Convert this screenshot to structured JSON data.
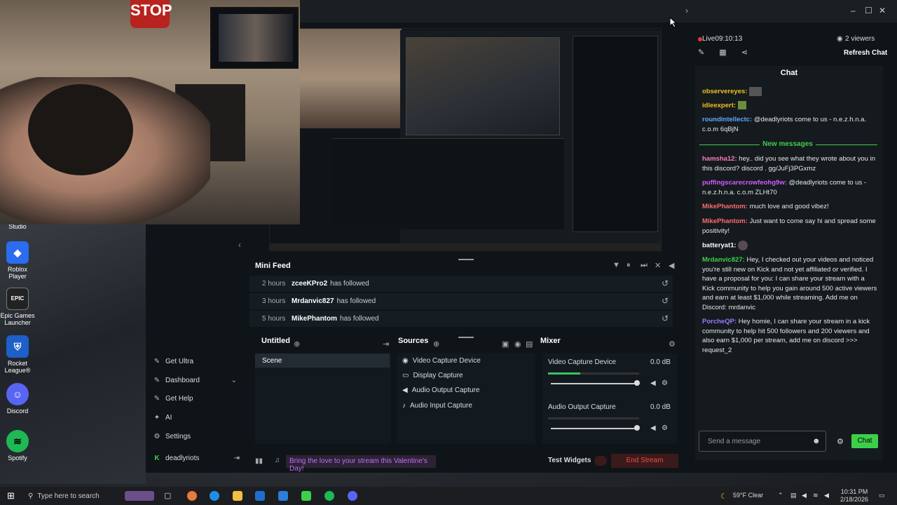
{
  "desktop": {
    "icons": [
      {
        "label": "Studio"
      },
      {
        "label": "Roblox Player"
      },
      {
        "label": "Epic Games Launcher"
      },
      {
        "label": "Rocket League®"
      },
      {
        "label": "Discord"
      },
      {
        "label": "Spotify"
      }
    ]
  },
  "webcam": {
    "sign_text": "STOP"
  },
  "sidebar": {
    "items": [
      {
        "label": "Get Ultra"
      },
      {
        "label": "Dashboard"
      },
      {
        "label": "Get Help"
      },
      {
        "label": "AI"
      },
      {
        "label": "Settings"
      },
      {
        "label": "deadlyriots"
      }
    ]
  },
  "mini_feed": {
    "title": "Mini Feed",
    "rows": [
      {
        "time": "2 hours",
        "user": "zceeKPro2",
        "action": "has followed"
      },
      {
        "time": "3 hours",
        "user": "Mrdanvic827",
        "action": "has followed"
      },
      {
        "time": "5 hours",
        "user": "MikePhantom",
        "action": "has followed"
      }
    ]
  },
  "scenes": {
    "title": "Untitled",
    "items": [
      "Scene"
    ]
  },
  "sources": {
    "title": "Sources",
    "items": [
      "Video Capture Device",
      "Display Capture",
      "Audio Output Capture",
      "Audio Input Capture"
    ]
  },
  "mixer": {
    "title": "Mixer",
    "channels": [
      {
        "name": "Video Capture Device",
        "db": "0.0 dB",
        "level": 0.35
      },
      {
        "name": "Audio Output Capture",
        "db": "0.0 dB",
        "level": 0.0
      }
    ]
  },
  "statusbar": {
    "banner": "Bring the love to your stream this Valentine's Day!",
    "test_widgets": "Test Widgets",
    "end_stream": "End Stream"
  },
  "chat": {
    "live": "Live09:10:13",
    "viewers": "2 viewers",
    "refresh": "Refresh Chat",
    "title": "Chat",
    "new_messages": "New messages",
    "messages": [
      {
        "user": "observereyes:",
        "text": "",
        "color": "#f0c020"
      },
      {
        "user": "idleexpert:",
        "text": "",
        "color": "#f0c020"
      },
      {
        "user": "roundintellectc:",
        "text": "@deadlyriots come to us - n.e.z.h.n.a. c.o.m 6qBjN",
        "color": "#5fa8ff"
      },
      {
        "user": "hamsha12:",
        "text": "hey.. did you see what they wrote about you in this discord? discord . gg/JuFj3PGxmz",
        "color": "#ff7ab8"
      },
      {
        "user": "puffingscarecrowfeohg9w:",
        "text": "@deadlyriots come to us - n.e.z.h.n.a. c.o.m ZLHt70",
        "color": "#d35cff"
      },
      {
        "user": "MikePhantom:",
        "text": "much love and good vibez!",
        "color": "#ff6b6b"
      },
      {
        "user": "MikePhantom:",
        "text": "Just want to come say hi and spread some positivity!",
        "color": "#ff6b6b"
      },
      {
        "user": "batteryat1:",
        "text": "",
        "color": "#ffffff"
      },
      {
        "user": "Mrdanvic827:",
        "text": "Hey, I checked out your videos and noticed you're still new on Kick and not yet affiliated or verified. I have a proposal for you: I can share your stream with a Kick community to help you gain around 500 active viewers and earn at least $1,000 while streaming. Add me on Discord: mrdanvic",
        "color": "#3cd04a"
      },
      {
        "user": "PorcheQP:",
        "text": "Hey homie, I can share your stream in a kick community to help hit 500 followers and 200 viewers and also earn $1,000 per stream, add me on discord >>> request_2",
        "color": "#9a7aff"
      }
    ],
    "input_placeholder": "Send a message",
    "send_label": "Chat"
  },
  "taskbar": {
    "search_placeholder": "Type here to search",
    "weather": "59°F  Clear",
    "time": "10:31 PM",
    "date": "2/18/2026"
  }
}
